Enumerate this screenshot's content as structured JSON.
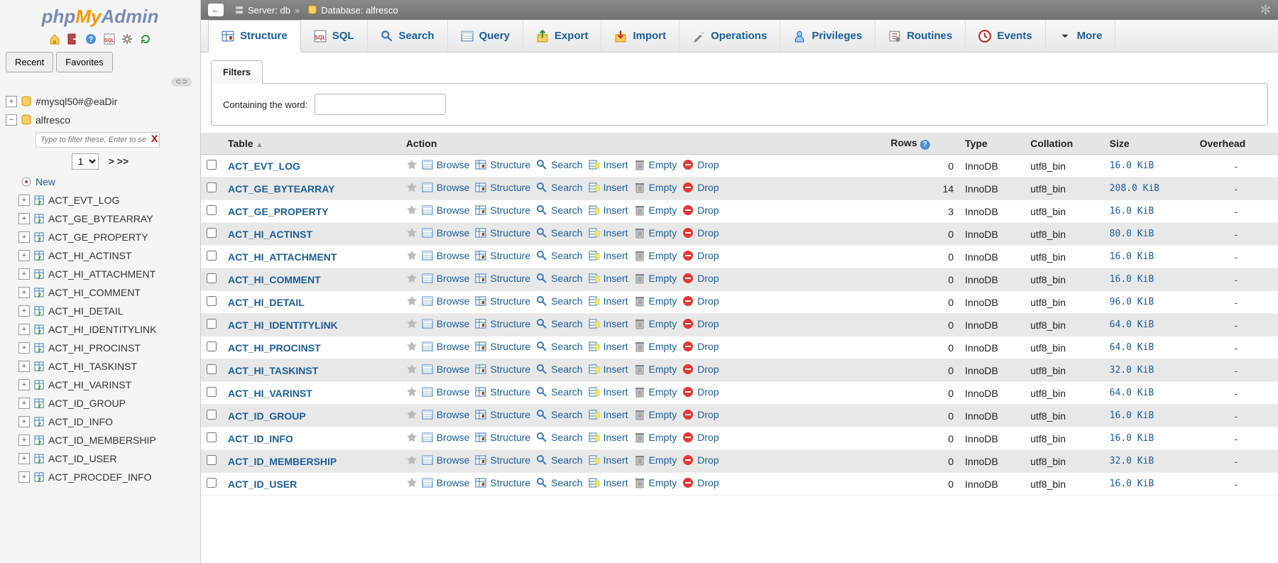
{
  "logo": {
    "p1": "php",
    "p2": "My",
    "p3": "Admin"
  },
  "sidebar_tabs": {
    "recent": "Recent",
    "favorites": "Favorites"
  },
  "tree": {
    "db1": "#mysql50#@eaDir",
    "db2": "alfresco",
    "filter_placeholder": "Type to filter these, Enter to search",
    "page": "1",
    "pager_next": "> >>",
    "new_label": "New",
    "tables": [
      "ACT_EVT_LOG",
      "ACT_GE_BYTEARRAY",
      "ACT_GE_PROPERTY",
      "ACT_HI_ACTINST",
      "ACT_HI_ATTACHMENT",
      "ACT_HI_COMMENT",
      "ACT_HI_DETAIL",
      "ACT_HI_IDENTITYLINK",
      "ACT_HI_PROCINST",
      "ACT_HI_TASKINST",
      "ACT_HI_VARINST",
      "ACT_ID_GROUP",
      "ACT_ID_INFO",
      "ACT_ID_MEMBERSHIP",
      "ACT_ID_USER",
      "ACT_PROCDEF_INFO"
    ]
  },
  "topbar": {
    "server_label": "Server:",
    "server": "db",
    "db_label": "Database:",
    "db": "alfresco"
  },
  "maintabs": [
    "Structure",
    "SQL",
    "Search",
    "Query",
    "Export",
    "Import",
    "Operations",
    "Privileges",
    "Routines",
    "Events",
    "More"
  ],
  "filters": {
    "title": "Filters",
    "containing": "Containing the word:"
  },
  "headers": {
    "table": "Table",
    "action": "Action",
    "rows": "Rows",
    "type": "Type",
    "collation": "Collation",
    "size": "Size",
    "overhead": "Overhead"
  },
  "actions": {
    "browse": "Browse",
    "structure": "Structure",
    "search": "Search",
    "insert": "Insert",
    "empty": "Empty",
    "drop": "Drop"
  },
  "rows": [
    {
      "name": "ACT_EVT_LOG",
      "rows": "0",
      "type": "InnoDB",
      "collation": "utf8_bin",
      "size": "16.0 KiB",
      "overhead": "-"
    },
    {
      "name": "ACT_GE_BYTEARRAY",
      "rows": "14",
      "type": "InnoDB",
      "collation": "utf8_bin",
      "size": "208.0 KiB",
      "overhead": "-"
    },
    {
      "name": "ACT_GE_PROPERTY",
      "rows": "3",
      "type": "InnoDB",
      "collation": "utf8_bin",
      "size": "16.0 KiB",
      "overhead": "-"
    },
    {
      "name": "ACT_HI_ACTINST",
      "rows": "0",
      "type": "InnoDB",
      "collation": "utf8_bin",
      "size": "80.0 KiB",
      "overhead": "-"
    },
    {
      "name": "ACT_HI_ATTACHMENT",
      "rows": "0",
      "type": "InnoDB",
      "collation": "utf8_bin",
      "size": "16.0 KiB",
      "overhead": "-"
    },
    {
      "name": "ACT_HI_COMMENT",
      "rows": "0",
      "type": "InnoDB",
      "collation": "utf8_bin",
      "size": "16.0 KiB",
      "overhead": "-"
    },
    {
      "name": "ACT_HI_DETAIL",
      "rows": "0",
      "type": "InnoDB",
      "collation": "utf8_bin",
      "size": "96.0 KiB",
      "overhead": "-"
    },
    {
      "name": "ACT_HI_IDENTITYLINK",
      "rows": "0",
      "type": "InnoDB",
      "collation": "utf8_bin",
      "size": "64.0 KiB",
      "overhead": "-"
    },
    {
      "name": "ACT_HI_PROCINST",
      "rows": "0",
      "type": "InnoDB",
      "collation": "utf8_bin",
      "size": "64.0 KiB",
      "overhead": "-"
    },
    {
      "name": "ACT_HI_TASKINST",
      "rows": "0",
      "type": "InnoDB",
      "collation": "utf8_bin",
      "size": "32.0 KiB",
      "overhead": "-"
    },
    {
      "name": "ACT_HI_VARINST",
      "rows": "0",
      "type": "InnoDB",
      "collation": "utf8_bin",
      "size": "64.0 KiB",
      "overhead": "-"
    },
    {
      "name": "ACT_ID_GROUP",
      "rows": "0",
      "type": "InnoDB",
      "collation": "utf8_bin",
      "size": "16.0 KiB",
      "overhead": "-"
    },
    {
      "name": "ACT_ID_INFO",
      "rows": "0",
      "type": "InnoDB",
      "collation": "utf8_bin",
      "size": "16.0 KiB",
      "overhead": "-"
    },
    {
      "name": "ACT_ID_MEMBERSHIP",
      "rows": "0",
      "type": "InnoDB",
      "collation": "utf8_bin",
      "size": "32.0 KiB",
      "overhead": "-"
    },
    {
      "name": "ACT_ID_USER",
      "rows": "0",
      "type": "InnoDB",
      "collation": "utf8_bin",
      "size": "16.0 KiB",
      "overhead": "-"
    }
  ]
}
